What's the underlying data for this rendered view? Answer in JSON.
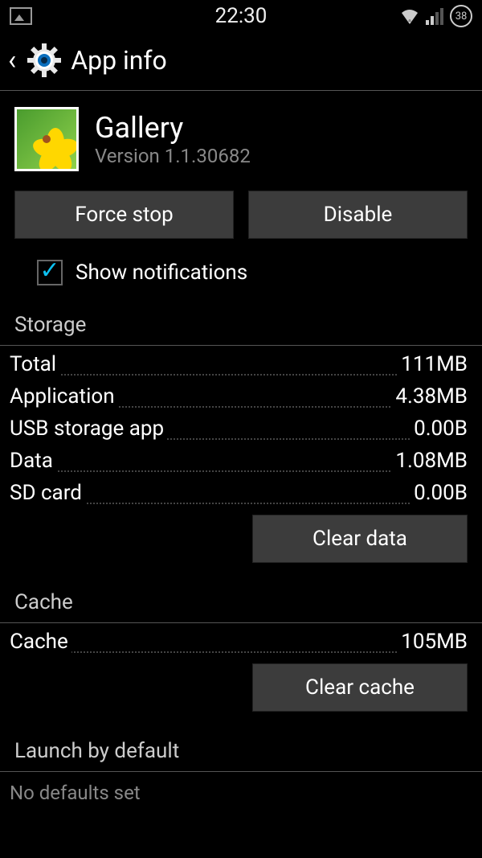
{
  "status": {
    "time": "22:30",
    "battery": "38"
  },
  "header": {
    "title": "App info"
  },
  "app": {
    "name": "Gallery",
    "version": "Version 1.1.30682"
  },
  "buttons": {
    "force_stop": "Force stop",
    "disable": "Disable",
    "clear_data": "Clear data",
    "clear_cache": "Clear cache"
  },
  "checkbox": {
    "show_notifications": "Show notifications",
    "checked": true
  },
  "sections": {
    "storage": "Storage",
    "cache": "Cache",
    "launch": "Launch by default"
  },
  "storage": {
    "rows": [
      {
        "label": "Total",
        "value": "111MB"
      },
      {
        "label": "Application",
        "value": "4.38MB"
      },
      {
        "label": "USB storage app",
        "value": "0.00B"
      },
      {
        "label": "Data",
        "value": "1.08MB"
      },
      {
        "label": "SD card",
        "value": "0.00B"
      }
    ]
  },
  "cache": {
    "label": "Cache",
    "value": "105MB"
  },
  "launch": {
    "no_defaults": "No defaults set"
  }
}
